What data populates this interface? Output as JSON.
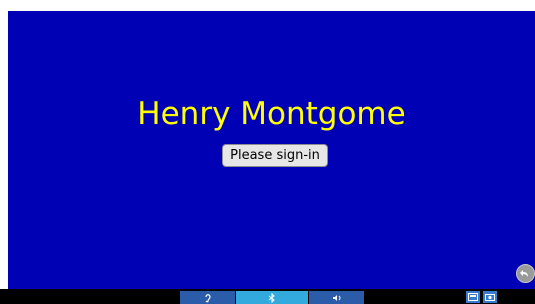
{
  "presenter_name": "Henry Montgome",
  "signin_label": "Please sign-in",
  "colors": {
    "screen_bg": "#0000b5",
    "title_text": "#ffff00",
    "taskbar_bg": "#000000"
  },
  "taskbar": {
    "icons": [
      "ear-icon",
      "bluetooth-icon",
      "speaker-icon",
      "image-icon",
      "camera-icon"
    ]
  },
  "back_button_icon": "back-arrow-icon"
}
